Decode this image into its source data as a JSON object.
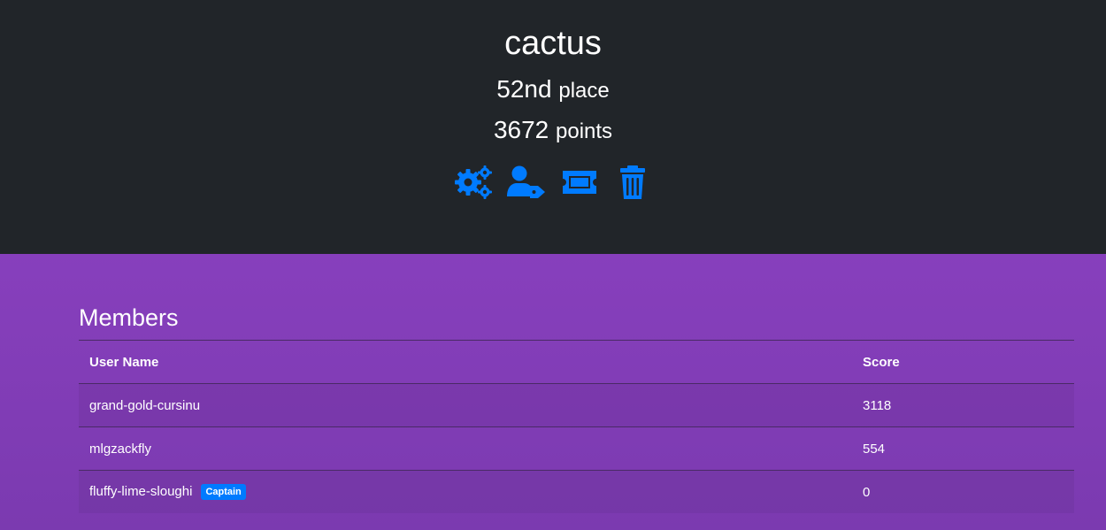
{
  "team": {
    "name": "cactus",
    "place": "52nd",
    "place_label": "place",
    "points": "3672",
    "points_label": "points"
  },
  "actions": [
    {
      "icon": "settings-icon",
      "color": "#007bff"
    },
    {
      "icon": "user-tag-icon",
      "color": "#007bff"
    },
    {
      "icon": "ticket-icon",
      "color": "#007bff"
    },
    {
      "icon": "trash-icon",
      "color": "#007bff"
    }
  ],
  "members": {
    "title": "Members",
    "columns": [
      "User Name",
      "Score"
    ],
    "rows": [
      {
        "name": "grand-gold-cursinu",
        "score": "3118",
        "badge": ""
      },
      {
        "name": "mlgzackfly",
        "score": "554",
        "badge": ""
      },
      {
        "name": "fluffy-lime-sloughi",
        "score": "0",
        "badge": "Captain"
      }
    ]
  }
}
